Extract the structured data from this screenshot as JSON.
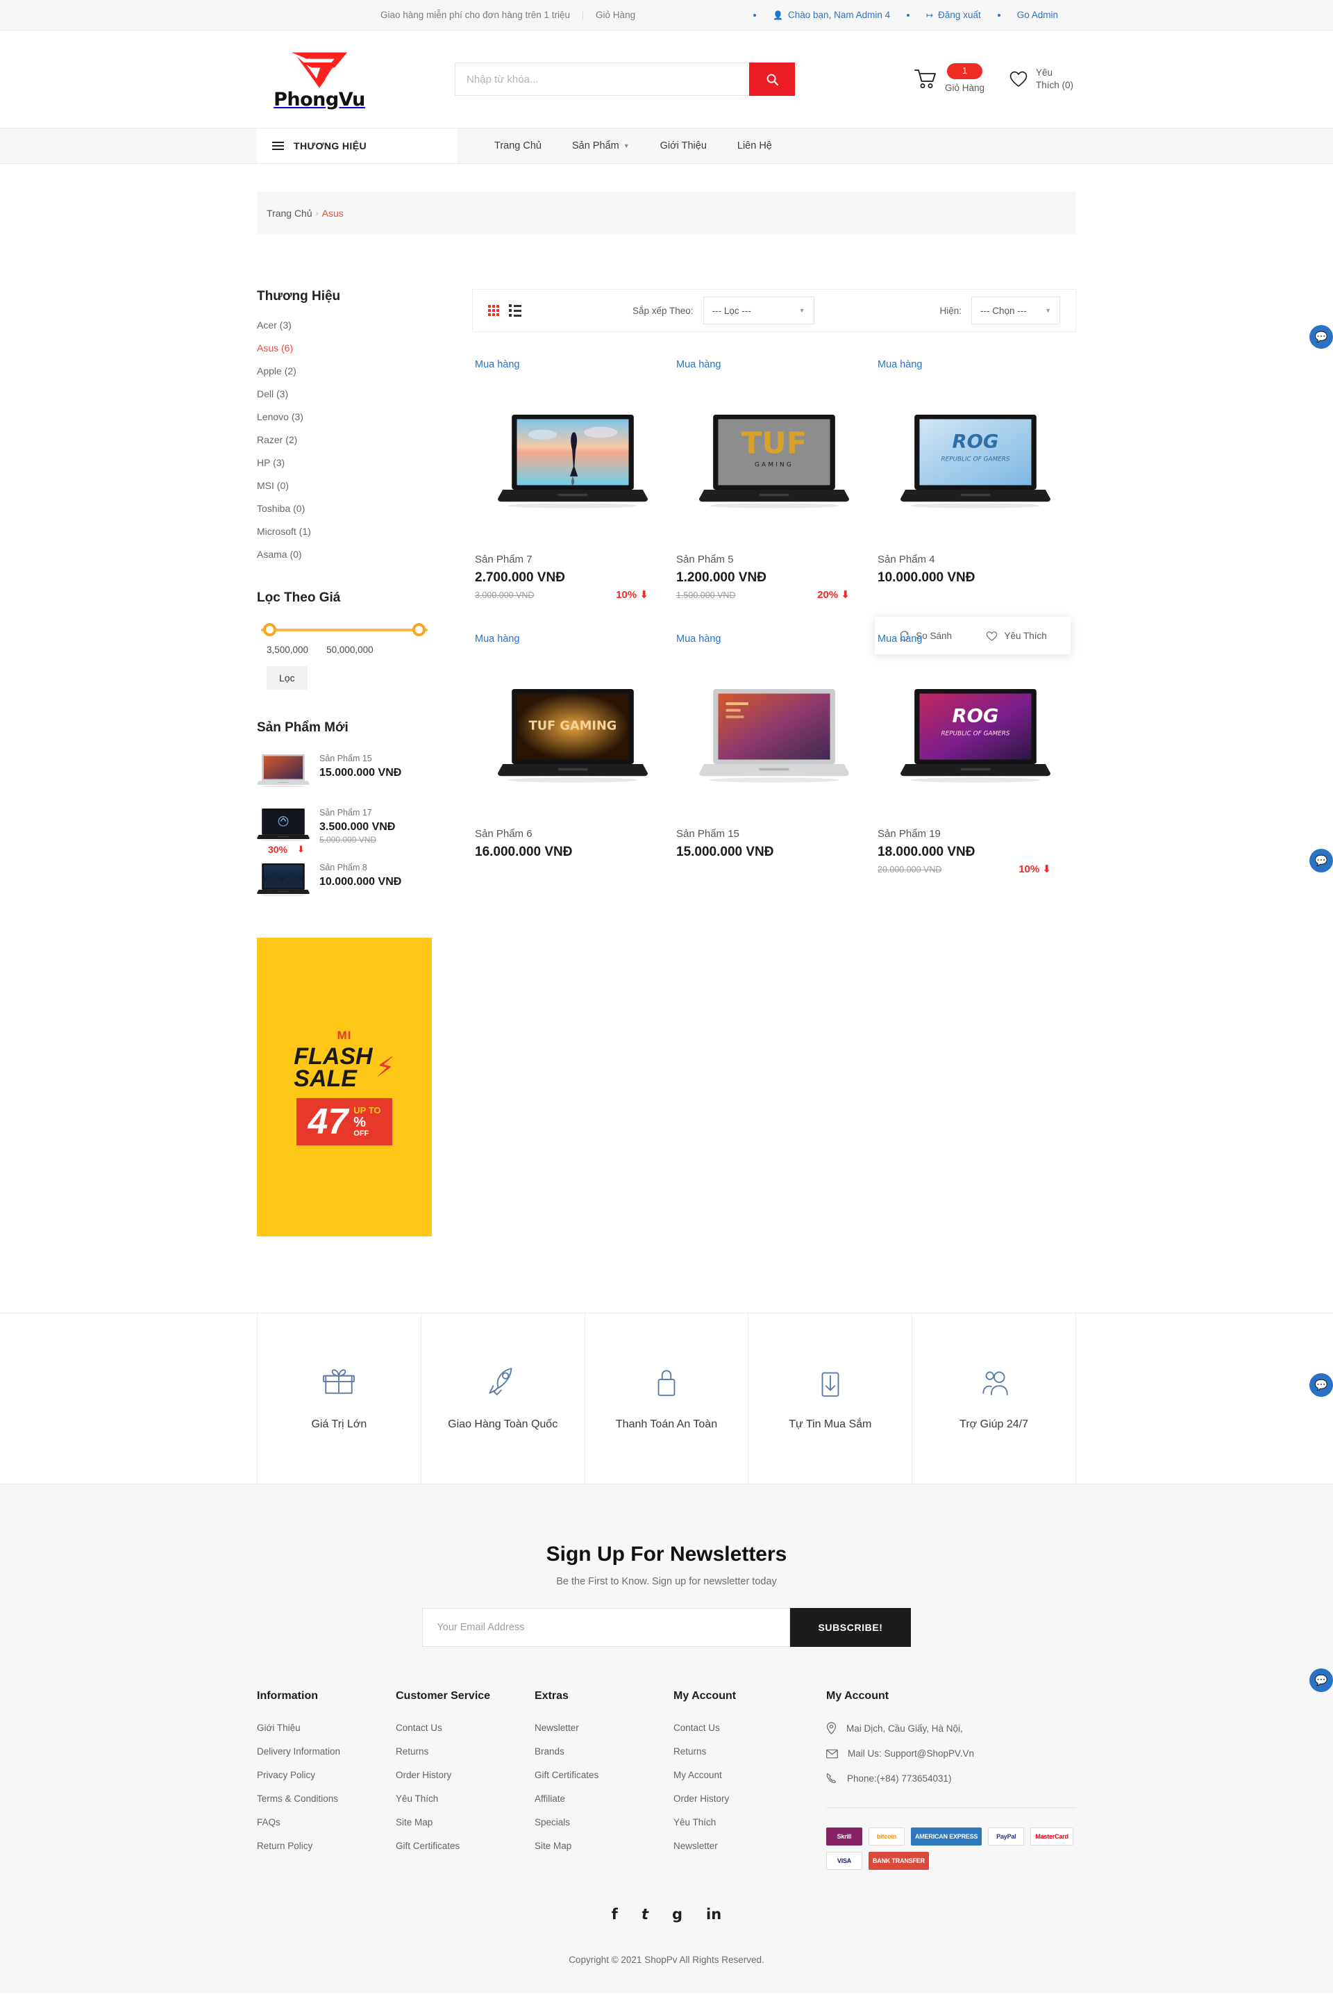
{
  "topbar": {
    "shipping_note": "Giao hàng miễn phí cho đơn hàng trên 1 triệu",
    "cart_label": "Giỏ Hàng",
    "greeting": "Chào bạn, Nam Admin 4",
    "logout": "Đăng xuất",
    "go_admin": "Go Admin"
  },
  "header": {
    "logo_text": "PhongVu",
    "search_placeholder": "Nhập từ khóa...",
    "cart_count": "1",
    "cart_label": "Giỏ Hàng",
    "wishlist_label": "Yêu Thích (0)"
  },
  "nav": {
    "brand_button": "THƯƠNG HIỆU",
    "links": [
      {
        "label": "Trang Chủ",
        "has_caret": false
      },
      {
        "label": "Sản Phẩm",
        "has_caret": true
      },
      {
        "label": "Giới Thiệu",
        "has_caret": false
      },
      {
        "label": "Liên Hệ",
        "has_caret": false
      }
    ]
  },
  "breadcrumb": {
    "home": "Trang Chủ",
    "current": "Asus"
  },
  "sidebar": {
    "brand_title": "Thương Hiệu",
    "brands": [
      {
        "label": "Acer (3)",
        "active": false
      },
      {
        "label": "Asus (6)",
        "active": true
      },
      {
        "label": "Apple (2)",
        "active": false
      },
      {
        "label": "Dell (3)",
        "active": false
      },
      {
        "label": "Lenovo (3)",
        "active": false
      },
      {
        "label": "Razer (2)",
        "active": false
      },
      {
        "label": "HP (3)",
        "active": false
      },
      {
        "label": "MSI (0)",
        "active": false
      },
      {
        "label": "Toshiba (0)",
        "active": false
      },
      {
        "label": "Microsoft (1)",
        "active": false
      },
      {
        "label": "Asama (0)",
        "active": false
      }
    ],
    "price_title": "Lọc Theo Giá",
    "price_min": "3,500,000",
    "price_max": "50,000,000",
    "filter_button": "Lọc",
    "new_title": "Sản Phẩm Mới",
    "new_products": [
      {
        "name": "Sản Phẩm 15",
        "price": "15.000.000 VNĐ",
        "old_price": "",
        "discount": ""
      },
      {
        "name": "Sản Phẩm 17",
        "price": "3.500.000 VNĐ",
        "old_price": "5.000.000 VND",
        "discount": "30%"
      },
      {
        "name": "Sản Phẩm 8",
        "price": "10.000.000 VNĐ",
        "old_price": "",
        "discount": ""
      }
    ],
    "banner": {
      "brand": "MI",
      "line1": "FLASH",
      "line2": "SALE",
      "upto": "UP TO",
      "percent": "47",
      "pct_sign": "%",
      "off": "OFF"
    }
  },
  "toolbar": {
    "sort_label": "Sắp xếp Theo:",
    "sort_value": "--- Lọc ---",
    "show_label": "Hiện:",
    "show_value": "--- Chọn ---"
  },
  "products": [
    {
      "buy": "Mua hàng",
      "name": "Sản Phẩm 7",
      "price": "2.700.000 VNĐ",
      "old_price": "3.000.000 VND",
      "discount": "10%",
      "image": "dell-sunset",
      "hover": false
    },
    {
      "buy": "Mua hàng",
      "name": "Sản Phẩm 5",
      "price": "1.200.000 VNĐ",
      "old_price": "1.500.000 VND",
      "discount": "20%",
      "image": "tuf-gaming",
      "hover": false
    },
    {
      "buy": "Mua hàng",
      "name": "Sản Phẩm 4",
      "price": "10.000.000 VNĐ",
      "old_price": "",
      "discount": "",
      "image": "rog-blue",
      "hover": true
    },
    {
      "buy": "Mua hàng",
      "name": "Sản Phẩm 6",
      "price": "16.000.000 VNĐ",
      "old_price": "",
      "discount": "",
      "image": "tuf-orange",
      "hover": false
    },
    {
      "buy": "Mua hàng",
      "name": "Sản Phẩm 15",
      "price": "15.000.000 VNĐ",
      "old_price": "",
      "discount": "",
      "image": "vivobook",
      "hover": false
    },
    {
      "buy": "Mua hàng",
      "name": "Sản Phẩm 19",
      "price": "18.000.000 VNĐ",
      "old_price": "20.000.000 VND",
      "discount": "10%",
      "image": "rog-red",
      "hover": false
    }
  ],
  "hover_actions": {
    "compare": "So Sánh",
    "wishlist": "Yêu Thích"
  },
  "features": [
    {
      "icon": "gift-icon",
      "label": "Giá Trị Lớn"
    },
    {
      "icon": "rocket-icon",
      "label": "Giao Hàng Toàn Quốc"
    },
    {
      "icon": "lock-icon",
      "label": "Thanh Toán An Toàn"
    },
    {
      "icon": "download-icon",
      "label": "Tự Tin Mua Sắm"
    },
    {
      "icon": "users-icon",
      "label": "Trợ Giúp 24/7"
    }
  ],
  "newsletter": {
    "title": "Sign Up For Newsletters",
    "subtitle": "Be the First to Know. Sign up for newsletter today",
    "placeholder": "Your Email Address",
    "button": "SUBSCRIBE!"
  },
  "footer": {
    "columns": [
      {
        "title": "Information",
        "links": [
          "Giới Thiệu",
          "Delivery Information",
          "Privacy Policy",
          "Terms & Conditions",
          "FAQs",
          "Return Policy"
        ]
      },
      {
        "title": "Customer Service",
        "links": [
          "Contact Us",
          "Returns",
          "Order History",
          "Yêu Thích",
          "Site Map",
          "Gift Certificates"
        ]
      },
      {
        "title": "Extras",
        "links": [
          "Newsletter",
          "Brands",
          "Gift Certificates",
          "Affiliate",
          "Specials",
          "Site Map"
        ]
      },
      {
        "title": "My Account",
        "links": [
          "Contact Us",
          "Returns",
          "My Account",
          "Order History",
          "Yêu Thích",
          "Newsletter"
        ]
      }
    ],
    "contact": {
      "title": "My Account",
      "address": "Mai Dịch, Cầu Giấy, Hà Nội,",
      "mail": "Mail Us: Support@ShopPV.Vn",
      "phone": "Phone:(+84) 773654031)"
    },
    "payments": [
      {
        "name": "Skrill",
        "bg": "#862165",
        "fg": "#ffffff"
      },
      {
        "name": "bitcoin",
        "bg": "#ffffff",
        "fg": "#f7931a"
      },
      {
        "name": "AMERICAN EXPRESS",
        "bg": "#2e77bc",
        "fg": "#ffffff"
      },
      {
        "name": "PayPal",
        "bg": "#ffffff",
        "fg": "#253b80"
      },
      {
        "name": "MasterCard",
        "bg": "#ffffff",
        "fg": "#eb001b"
      },
      {
        "name": "VISA",
        "bg": "#ffffff",
        "fg": "#1a1f71"
      },
      {
        "name": "BANK TRANSFER",
        "bg": "#d94a3d",
        "fg": "#ffffff"
      }
    ],
    "social": [
      "f",
      "t",
      "g",
      "in"
    ],
    "copyright": "Copyright © 2021 ShopPv All Rights Reserved."
  }
}
